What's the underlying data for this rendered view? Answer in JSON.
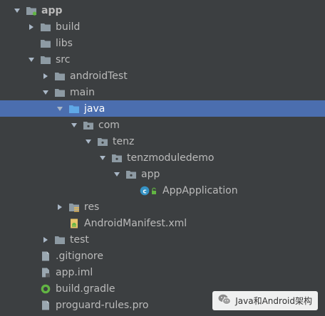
{
  "project_tree": {
    "items": [
      {
        "label": "app",
        "depth": 0,
        "expanded": true,
        "icon": "module-folder-icon"
      },
      {
        "label": "build",
        "depth": 1,
        "expanded": false,
        "icon": "folder-icon"
      },
      {
        "label": "libs",
        "depth": 1,
        "expanded": null,
        "icon": "folder-icon"
      },
      {
        "label": "src",
        "depth": 1,
        "expanded": true,
        "icon": "folder-icon"
      },
      {
        "label": "androidTest",
        "depth": 2,
        "expanded": false,
        "icon": "folder-icon"
      },
      {
        "label": "main",
        "depth": 2,
        "expanded": true,
        "icon": "folder-icon"
      },
      {
        "label": "java",
        "depth": 3,
        "expanded": true,
        "icon": "source-folder-icon",
        "selected": true
      },
      {
        "label": "com",
        "depth": 4,
        "expanded": true,
        "icon": "package-icon"
      },
      {
        "label": "tenz",
        "depth": 5,
        "expanded": true,
        "icon": "package-icon"
      },
      {
        "label": "tenzmoduledemo",
        "depth": 6,
        "expanded": true,
        "icon": "package-icon"
      },
      {
        "label": "app",
        "depth": 7,
        "expanded": true,
        "icon": "package-icon"
      },
      {
        "label": "AppApplication",
        "depth": 8,
        "expanded": null,
        "icon": "class-icon"
      },
      {
        "label": "res",
        "depth": 3,
        "expanded": false,
        "icon": "resource-folder-icon"
      },
      {
        "label": "AndroidManifest.xml",
        "depth": 3,
        "expanded": null,
        "icon": "manifest-file-icon"
      },
      {
        "label": "test",
        "depth": 2,
        "expanded": false,
        "icon": "folder-icon"
      },
      {
        "label": ".gitignore",
        "depth": 1,
        "expanded": null,
        "icon": "text-file-icon"
      },
      {
        "label": "app.iml",
        "depth": 1,
        "expanded": null,
        "icon": "iml-file-icon"
      },
      {
        "label": "build.gradle",
        "depth": 1,
        "expanded": null,
        "icon": "gradle-file-icon"
      },
      {
        "label": "proguard-rules.pro",
        "depth": 1,
        "expanded": null,
        "icon": "text-file-icon"
      }
    ]
  },
  "watermark": {
    "text": "Java和Android架构",
    "icon": "wechat-icon"
  },
  "colors": {
    "background": "#3c3f41",
    "selection": "#4b6eaf",
    "folder": "#8d9aa3",
    "source_folder": "#5fa8e6",
    "class_badge": "#3592c4"
  }
}
